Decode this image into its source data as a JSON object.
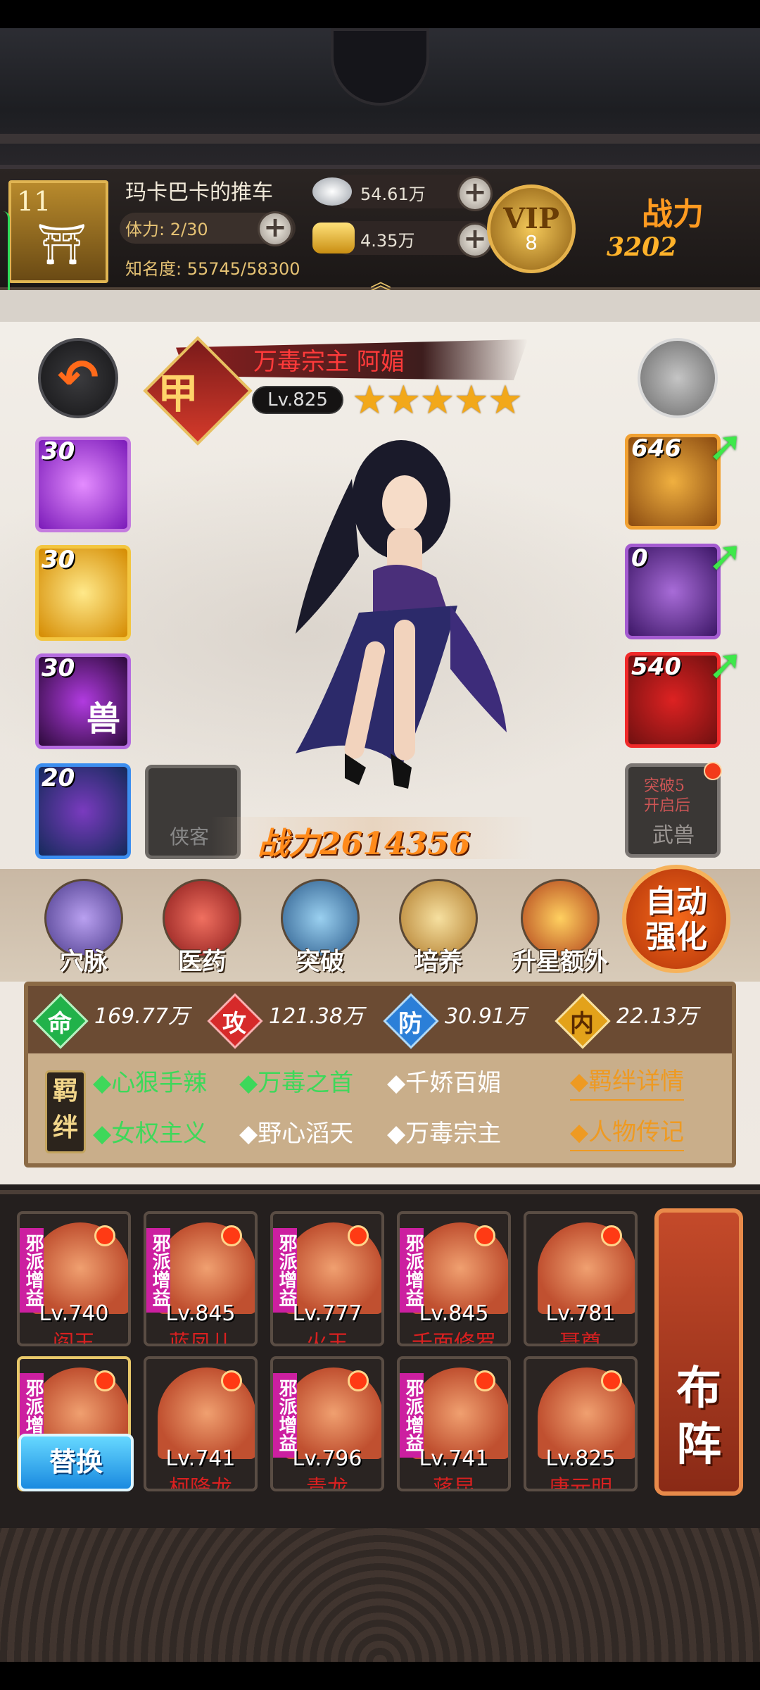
{
  "player": {
    "level": "11",
    "name": "玛卡巴卡的推车",
    "stamina": "体力: 2/30",
    "fame": "知名度: 55745/58300"
  },
  "resources": {
    "silver": "54.61万",
    "gold": "4.35万"
  },
  "vip": {
    "label": "VIP",
    "level": "8"
  },
  "top_power": {
    "label": "战力",
    "value": "3202"
  },
  "hero": {
    "title": "万毒宗主 阿媚",
    "rank_badge": "甲",
    "level": "Lv.825",
    "stars": 5,
    "power_label": "战力",
    "power": "2614356"
  },
  "skills": [
    {
      "level": "30"
    },
    {
      "level": "30"
    },
    {
      "level": "30",
      "glyph": "兽"
    },
    {
      "level": "20"
    }
  ],
  "xiake_slot": "侠客",
  "equipment": [
    {
      "level": "646"
    },
    {
      "level": "0"
    },
    {
      "level": "540"
    }
  ],
  "wushou": {
    "hint": "突破5\n开启后",
    "label": "武兽"
  },
  "functions": [
    "穴脉",
    "医药",
    "突破",
    "培养",
    "升星额外"
  ],
  "auto_btn": "自动\n强化",
  "stats": [
    {
      "glyph": "命",
      "value": "169.77万",
      "color": "#21b24a"
    },
    {
      "glyph": "攻",
      "value": "121.38万",
      "color": "#d62a2a"
    },
    {
      "glyph": "防",
      "value": "30.91万",
      "color": "#2b7fd8"
    },
    {
      "glyph": "内",
      "value": "22.13万",
      "color": "#e3a21a"
    }
  ],
  "jiban_label": "羁绊",
  "bonds": [
    {
      "text": "心狠手辣",
      "active": true
    },
    {
      "text": "万毒之首",
      "active": true
    },
    {
      "text": "千娇百媚",
      "active": false
    },
    {
      "text": "女权主义",
      "active": true
    },
    {
      "text": "野心滔天",
      "active": false
    },
    {
      "text": "万毒宗主",
      "active": false
    }
  ],
  "links": {
    "bond_detail": "◆羁绊详情",
    "bio": "◆人物传记"
  },
  "team_row1": [
    {
      "tag": "邪派增益",
      "level": "Lv.740",
      "name": "阎王"
    },
    {
      "tag": "邪派增益",
      "level": "Lv.845",
      "name": "蓝凤儿"
    },
    {
      "tag": "邪派增益",
      "level": "Lv.777",
      "name": "火王"
    },
    {
      "tag": "邪派增益",
      "level": "Lv.845",
      "name": "千面修罗"
    },
    {
      "tag": "",
      "level": "Lv.781",
      "name": "聂尊"
    }
  ],
  "team_row2": [
    {
      "tag": "邪派增益",
      "level": "",
      "name": ""
    },
    {
      "tag": "",
      "level": "Lv.741",
      "name": "柯降龙"
    },
    {
      "tag": "邪派增益",
      "level": "Lv.796",
      "name": "青龙"
    },
    {
      "tag": "邪派增益",
      "level": "Lv.741",
      "name": "蒋昆"
    },
    {
      "tag": "",
      "level": "Lv.825",
      "name": "唐元明"
    }
  ],
  "replace_btn": "替换",
  "formation_btn": "布\n阵"
}
